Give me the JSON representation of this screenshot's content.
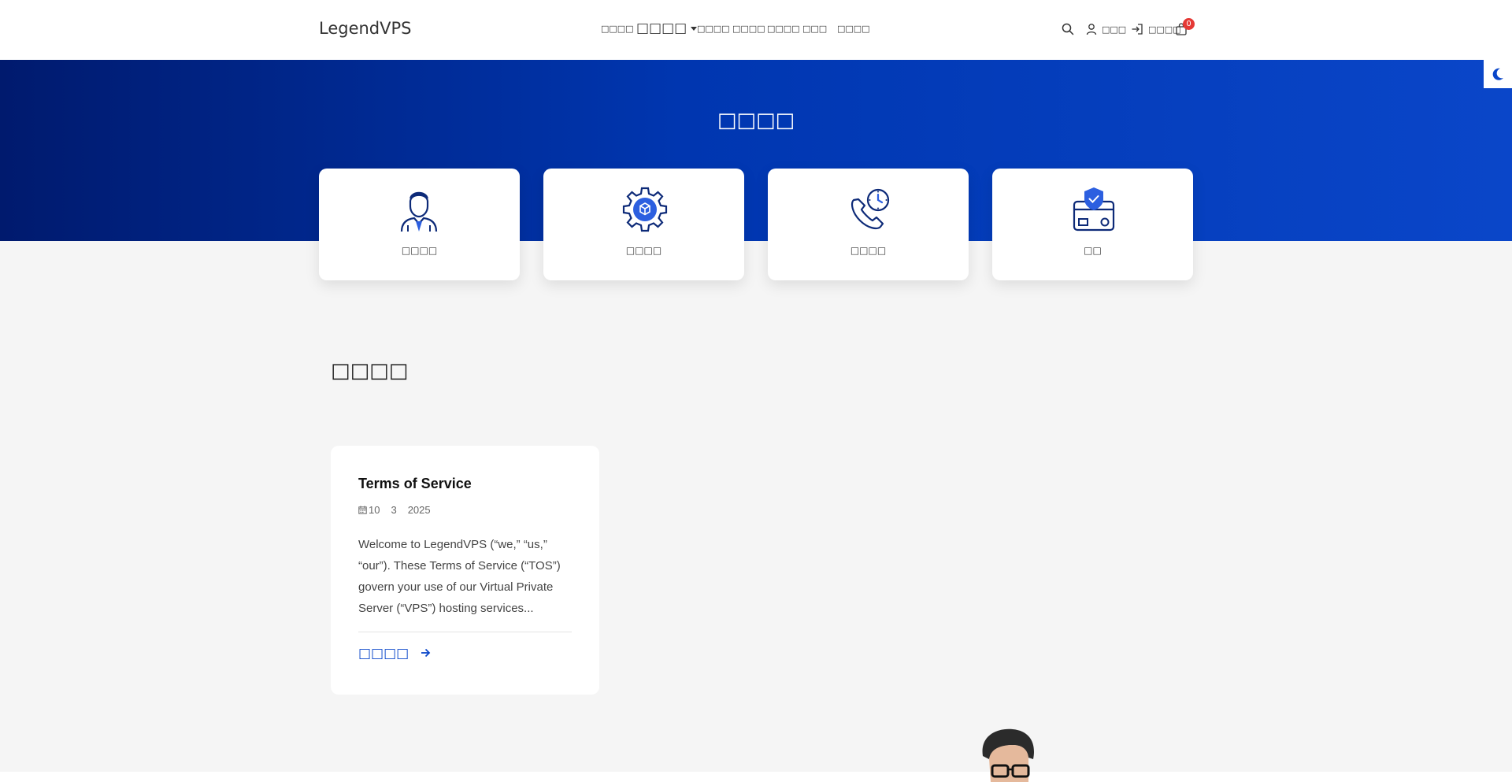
{
  "header": {
    "logo": "LegendVPS",
    "nav": [
      {
        "label": "□□□□"
      },
      {
        "label": "□□□□"
      },
      {
        "label": "□□□□"
      },
      {
        "label": "□□□□"
      },
      {
        "label": "□□□□"
      },
      {
        "label": "□□□"
      },
      {
        "label": "□□□□"
      }
    ],
    "account_label": "□□□",
    "login_label": "□□□□",
    "cart_count": "0"
  },
  "hero": {
    "title": "□□□□"
  },
  "cards": [
    {
      "label": "□□□□",
      "icon": "support-agent-icon"
    },
    {
      "label": "□□□□",
      "icon": "gear-network-icon"
    },
    {
      "label": "□□□□",
      "icon": "phone-clock-icon"
    },
    {
      "label": "□□",
      "icon": "shield-card-icon"
    }
  ],
  "section": {
    "title": "□□□□"
  },
  "post": {
    "title": "Terms of Service",
    "date_day": "10",
    "date_month": "3",
    "date_year": "2025",
    "excerpt": "Welcome to LegendVPS (“we,” “us,” “our”). These Terms of Service (“TOS”) govern your use of our Virtual Private Server (“VPS”) hosting services...",
    "read_more": "□□□□"
  },
  "colors": {
    "brand_blue": "#0a46c9",
    "hero_dark": "#001a6e",
    "badge_red": "#e53935"
  }
}
